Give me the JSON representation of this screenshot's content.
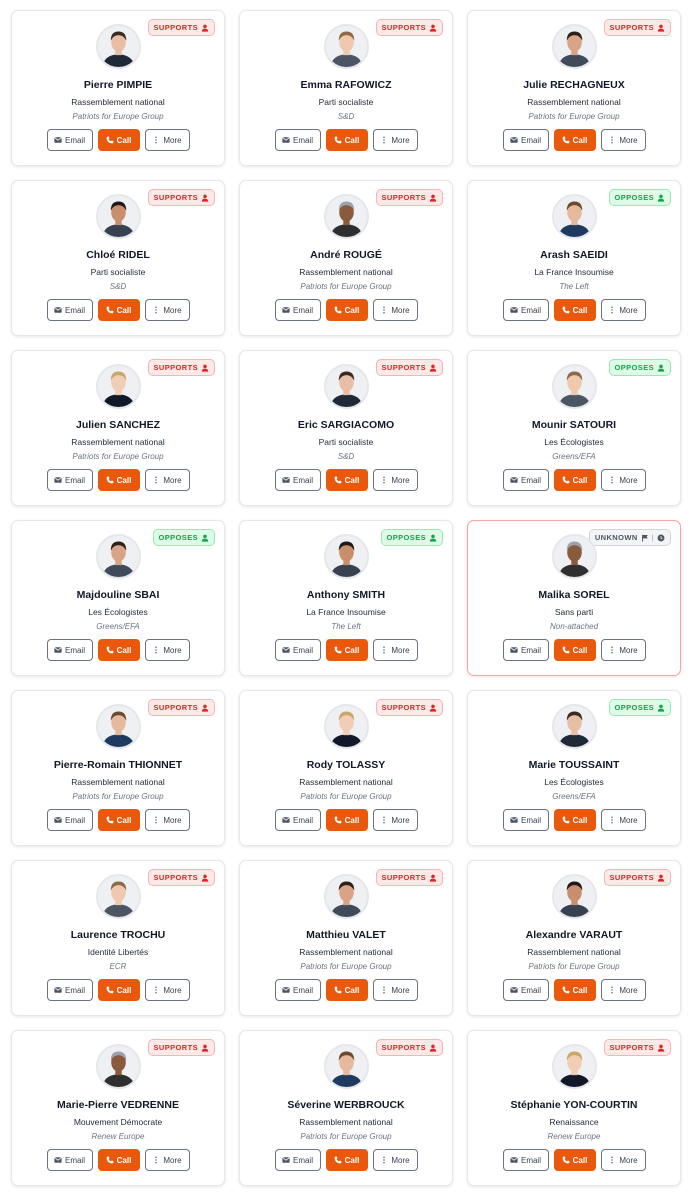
{
  "labels": {
    "email": "Email",
    "call": "Call",
    "more": "More",
    "supports": "SUPPORTS",
    "opposes": "OPPOSES",
    "unknown": "UNKNOWN"
  },
  "colors": {
    "supports": "#dc2626",
    "opposes": "#16a34a",
    "unknown": "#4b5563",
    "call_button": "#ea580c"
  },
  "icons": {
    "email": "mail-icon",
    "call": "phone-icon",
    "more": "vertical-dots-icon",
    "stance": "person-icon",
    "unknown_flag": "flag-icon",
    "unknown_clock": "clock-icon"
  },
  "meps": [
    {
      "name": "Pierre PIMPIE",
      "party": "Rassemblement national",
      "group": "Patriots for Europe Group",
      "stance": "supports",
      "highlight": false
    },
    {
      "name": "Emma RAFOWICZ",
      "party": "Parti socialiste",
      "group": "S&D",
      "stance": "supports",
      "highlight": false
    },
    {
      "name": "Julie RECHAGNEUX",
      "party": "Rassemblement national",
      "group": "Patriots for Europe Group",
      "stance": "supports",
      "highlight": false
    },
    {
      "name": "Chloé RIDEL",
      "party": "Parti socialiste",
      "group": "S&D",
      "stance": "supports",
      "highlight": false
    },
    {
      "name": "André ROUGÉ",
      "party": "Rassemblement national",
      "group": "Patriots for Europe Group",
      "stance": "supports",
      "highlight": false
    },
    {
      "name": "Arash SAEIDI",
      "party": "La France Insoumise",
      "group": "The Left",
      "stance": "opposes",
      "highlight": false
    },
    {
      "name": "Julien SANCHEZ",
      "party": "Rassemblement national",
      "group": "Patriots for Europe Group",
      "stance": "supports",
      "highlight": false
    },
    {
      "name": "Eric SARGIACOMO",
      "party": "Parti socialiste",
      "group": "S&D",
      "stance": "supports",
      "highlight": false
    },
    {
      "name": "Mounir SATOURI",
      "party": "Les Écologistes",
      "group": "Greens/EFA",
      "stance": "opposes",
      "highlight": false
    },
    {
      "name": "Majdouline SBAI",
      "party": "Les Écologistes",
      "group": "Greens/EFA",
      "stance": "opposes",
      "highlight": false
    },
    {
      "name": "Anthony SMITH",
      "party": "La France Insoumise",
      "group": "The Left",
      "stance": "opposes",
      "highlight": false
    },
    {
      "name": "Malika SOREL",
      "party": "Sans parti",
      "group": "Non-attached",
      "stance": "unknown",
      "highlight": true
    },
    {
      "name": "Pierre-Romain THIONNET",
      "party": "Rassemblement national",
      "group": "Patriots for Europe Group",
      "stance": "supports",
      "highlight": false
    },
    {
      "name": "Rody TOLASSY",
      "party": "Rassemblement national",
      "group": "Patriots for Europe Group",
      "stance": "supports",
      "highlight": false
    },
    {
      "name": "Marie TOUSSAINT",
      "party": "Les Écologistes",
      "group": "Greens/EFA",
      "stance": "opposes",
      "highlight": false
    },
    {
      "name": "Laurence TROCHU",
      "party": "Identité Libertés",
      "group": "ECR",
      "stance": "supports",
      "highlight": false
    },
    {
      "name": "Matthieu VALET",
      "party": "Rassemblement national",
      "group": "Patriots for Europe Group",
      "stance": "supports",
      "highlight": false
    },
    {
      "name": "Alexandre VARAUT",
      "party": "Rassemblement national",
      "group": "Patriots for Europe Group",
      "stance": "supports",
      "highlight": false
    },
    {
      "name": "Marie-Pierre VEDRENNE",
      "party": "Mouvement Démocrate",
      "group": "Renew Europe",
      "stance": "supports",
      "highlight": false
    },
    {
      "name": "Séverine WERBROUCK",
      "party": "Rassemblement national",
      "group": "Patriots for Europe Group",
      "stance": "supports",
      "highlight": false
    },
    {
      "name": "Stéphanie YON-COURTIN",
      "party": "Renaissance",
      "group": "Renew Europe",
      "stance": "supports",
      "highlight": false
    }
  ]
}
